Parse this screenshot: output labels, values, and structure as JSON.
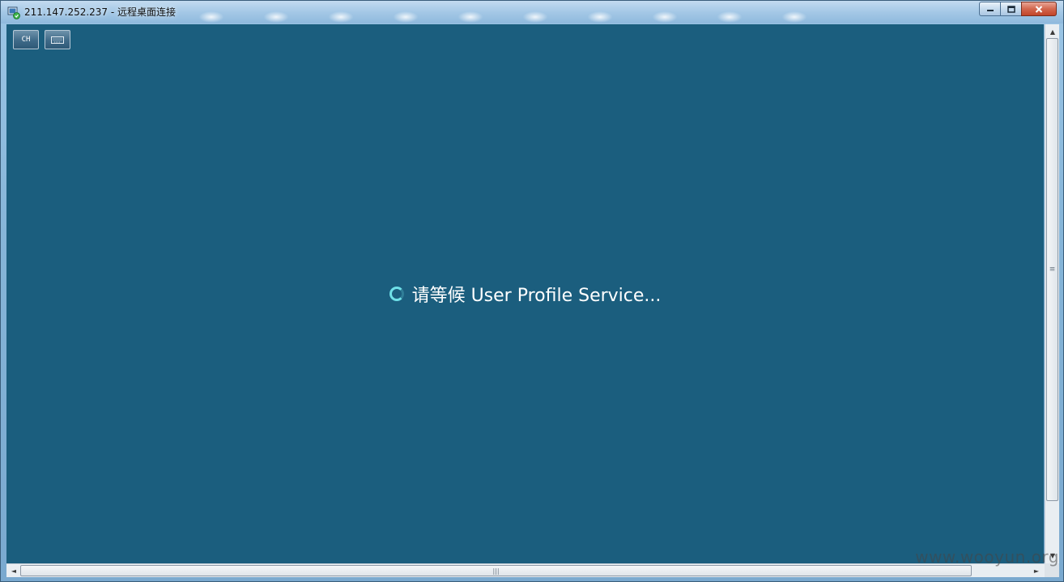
{
  "window": {
    "title": "211.147.252.237 - 远程桌面连接",
    "app_icon": "remote-desktop-icon",
    "controls": {
      "minimize_icon": "minimize-icon",
      "maximize_icon": "maximize-icon",
      "close_icon": "close-icon"
    }
  },
  "toolbar": {
    "language_label": "CH",
    "keyboard_icon": "keyboard-icon"
  },
  "main": {
    "status_text": "请等候 User Profile Service...",
    "spinner_icon": "loading-spinner-icon"
  },
  "scrollbars": {
    "vertical_grip": "≡",
    "horizontal_grip": "|||",
    "left_arrow": "◄",
    "right_arrow": "►",
    "up_arrow": "▲",
    "down_arrow": "▼"
  },
  "watermark": "www.wooyun.org",
  "colors": {
    "desktop_background": "#1b5e7e",
    "spinner": "#6fe0e8",
    "close_button": "#c2452a"
  }
}
